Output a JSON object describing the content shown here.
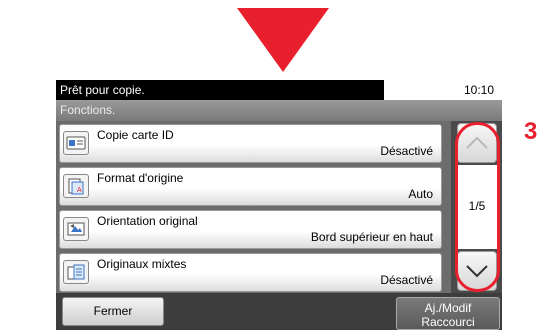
{
  "callout": {
    "step_number": "3"
  },
  "status_bar": {
    "status": "Prêt pour copie.",
    "time": "10:10"
  },
  "section": {
    "title": "Fonctions."
  },
  "items": [
    {
      "label": "Copie carte ID",
      "value": "Désactivé",
      "icon": "id-card-icon"
    },
    {
      "label": "Format d'origine",
      "value": "Auto",
      "icon": "original-size-icon"
    },
    {
      "label": "Orientation original",
      "value": "Bord supérieur en haut",
      "icon": "orientation-icon"
    },
    {
      "label": "Originaux mixtes",
      "value": "Désactivé",
      "icon": "mixed-originals-icon"
    }
  ],
  "scroll": {
    "page": "1/5"
  },
  "footer": {
    "close_label": "Fermer",
    "shortcut_line1": "Aj./Modif",
    "shortcut_line2": "Raccourci"
  },
  "colors": {
    "accent": "#e8202e",
    "panel_bg": "#3d3d3d"
  }
}
